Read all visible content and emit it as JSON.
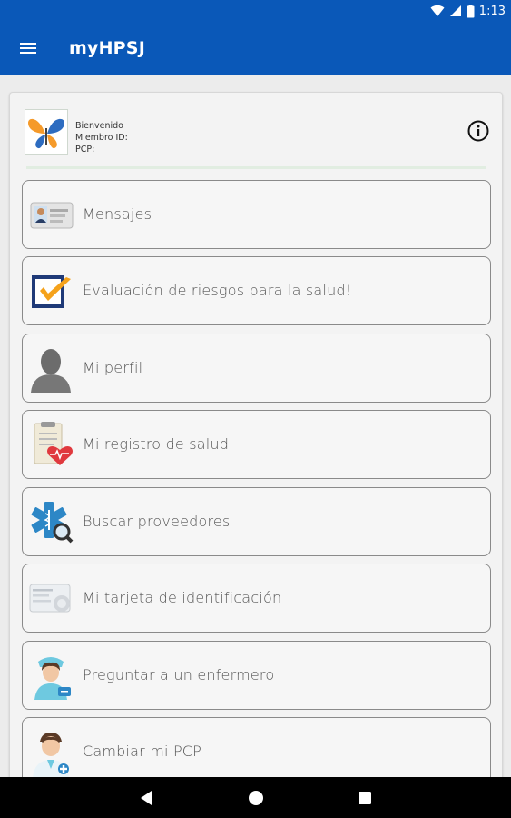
{
  "status_bar": {
    "time": "1:13"
  },
  "app_bar": {
    "title": "myHPSJ"
  },
  "member": {
    "welcome": "Bienvenido",
    "member_id_label": "Miembro ID:",
    "pcp_label": "PCP:"
  },
  "menu": {
    "items": [
      {
        "label": "Mensajes",
        "icon": "id-card-icon"
      },
      {
        "label": "Evaluación de riesgos para la salud!",
        "icon": "checkbox-check-icon"
      },
      {
        "label": "Mi perfil",
        "icon": "person-silhouette-icon"
      },
      {
        "label": "Mi registro de salud",
        "icon": "clipboard-heart-icon"
      },
      {
        "label": "Buscar proveedores",
        "icon": "star-of-life-search-icon"
      },
      {
        "label": "Mi tarjeta de identificación",
        "icon": "insurance-card-icon"
      },
      {
        "label": "Preguntar a un enfermero",
        "icon": "nurse-icon"
      },
      {
        "label": "Cambiar mi PCP",
        "icon": "doctor-icon"
      }
    ]
  },
  "colors": {
    "primary": "#0a58b8",
    "checkbox_orange": "#f5a21b",
    "checkbox_navy": "#1f3a78"
  }
}
